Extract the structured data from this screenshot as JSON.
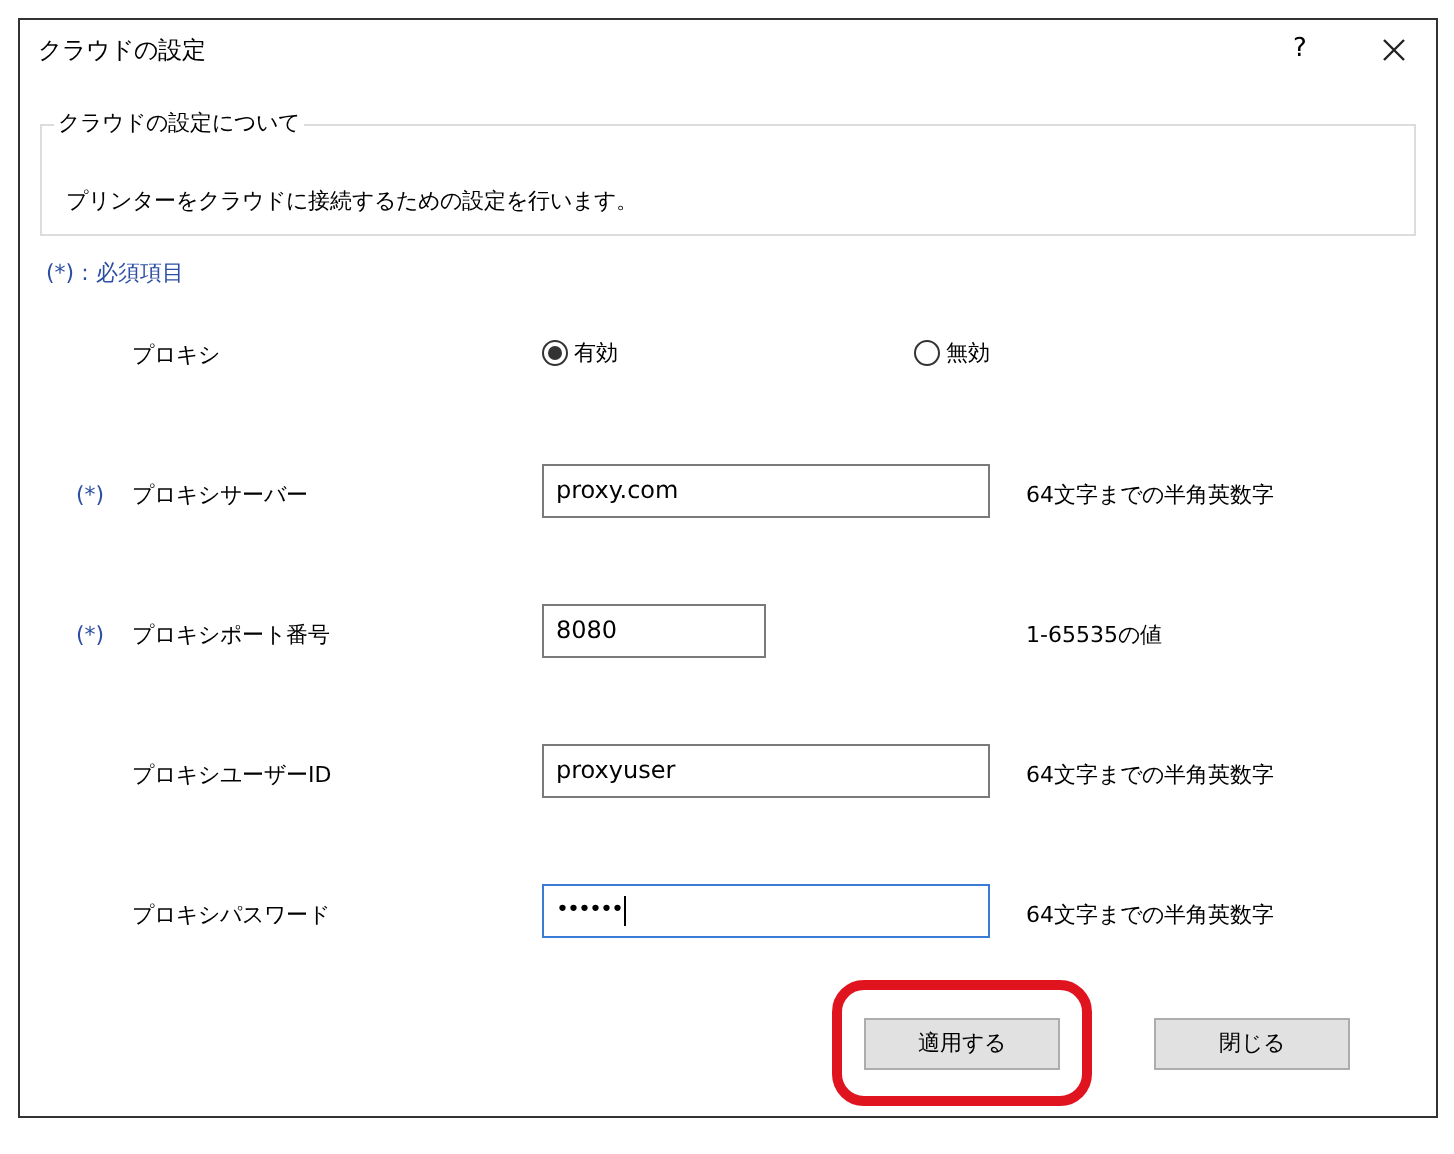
{
  "window": {
    "title": "クラウドの設定",
    "help": "?"
  },
  "group": {
    "title": "クラウドの設定について",
    "text": "プリンターをクラウドに接続するための設定を行います。"
  },
  "required_note": "(*) : 必須項目",
  "rows": [
    {
      "kind": "radio",
      "label": "プロキシ",
      "required": false,
      "options": [
        {
          "label": "有効",
          "selected": true
        },
        {
          "label": "無効",
          "selected": false
        }
      ]
    },
    {
      "kind": "text",
      "label": "プロキシサーバー",
      "required": true,
      "value": "proxy.com",
      "focused": false,
      "hint": "64文字までの半角英数字"
    },
    {
      "kind": "number",
      "label": "プロキシポート番号",
      "required": true,
      "value": "8080",
      "focused": false,
      "hint": "1-65535の値"
    },
    {
      "kind": "text",
      "label": "プロキシユーザーID",
      "required": false,
      "value": "proxyuser",
      "focused": false,
      "hint": "64文字までの半角英数字"
    },
    {
      "kind": "password",
      "label": "プロキシパスワード",
      "required": false,
      "value": "••••••",
      "focused": true,
      "hint": "64文字までの半角英数字"
    }
  ],
  "required_mark": "(*)",
  "buttons": [
    {
      "label": "適用する",
      "highlighted": true
    },
    {
      "label": "閉じる",
      "highlighted": false
    }
  ]
}
